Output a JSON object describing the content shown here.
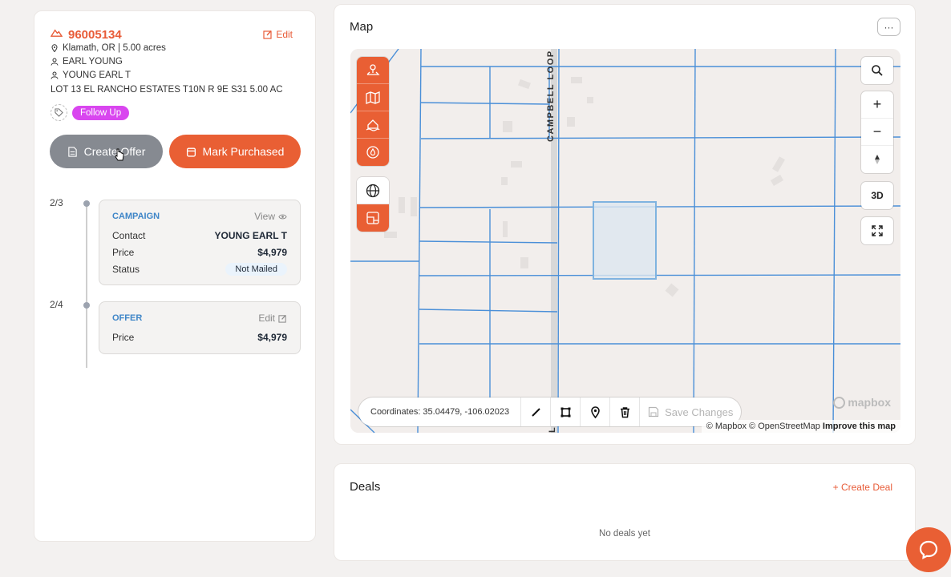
{
  "property": {
    "apn": "96005134",
    "edit_label": "Edit",
    "location": "Klamath, OR | 5.00 acres",
    "owner1": "EARL YOUNG",
    "owner2": "YOUNG EARL T",
    "legal": "LOT 13 EL RANCHO ESTATES T10N R 9E S31 5.00 AC",
    "tag": "Follow Up"
  },
  "actions": {
    "create_offer": "Create Offer",
    "mark_purchased": "Mark Purchased"
  },
  "timeline": [
    {
      "step": "2/3",
      "title": "CAMPAIGN",
      "action": "View",
      "rows": [
        {
          "k": "Contact",
          "v": "YOUNG EARL T"
        },
        {
          "k": "Price",
          "v": "$4,979"
        },
        {
          "k": "Status",
          "v": "Not Mailed"
        }
      ]
    },
    {
      "step": "2/4",
      "title": "OFFER",
      "action": "Edit",
      "rows": [
        {
          "k": "Price",
          "v": "$4,979"
        }
      ]
    }
  ],
  "map": {
    "title": "Map",
    "more": "···",
    "road_label": "CAMPBELL LOOP",
    "road_label_bottom": "LOOP",
    "coords": "Coordinates: 35.04479, -106.02023",
    "save_changes": "Save Changes",
    "zoom_in": "+",
    "zoom_out": "−",
    "three_d": "3D",
    "mapbox": "mapbox",
    "attribution_1": "© Mapbox © OpenStreetMap",
    "attribution_2": "Improve this map"
  },
  "deals": {
    "title": "Deals",
    "create": "+ Create Deal",
    "empty": "No deals yet"
  },
  "colors": {
    "accent": "#e95f34",
    "parcel_line": "#4a8fd8",
    "badge": "#d946ef",
    "stage_title": "#3f86c8"
  }
}
